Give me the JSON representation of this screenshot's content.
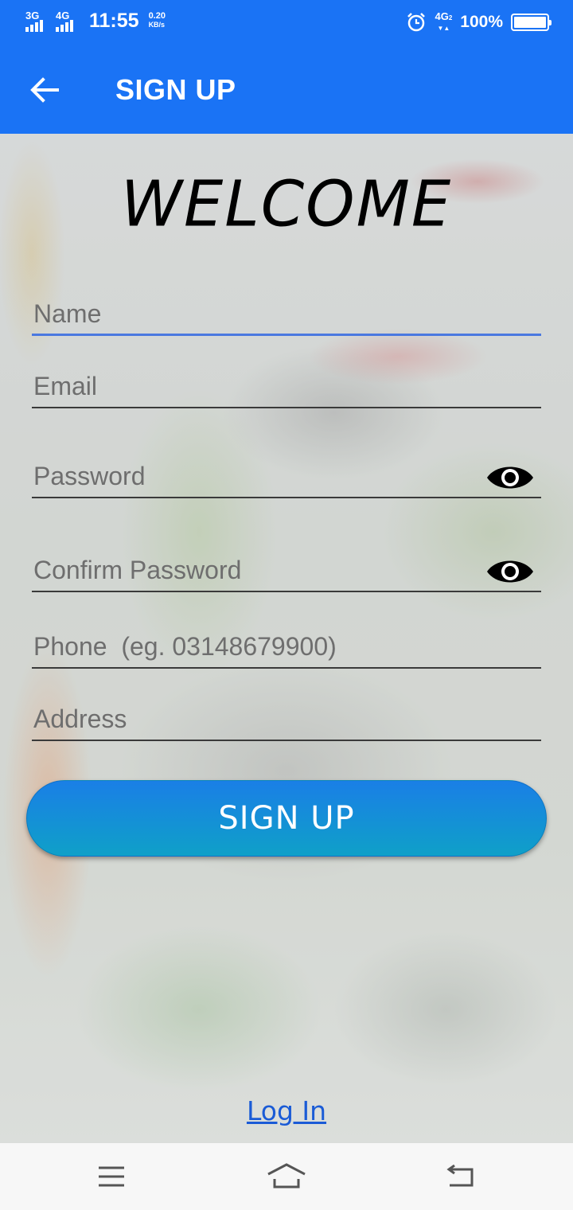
{
  "status_bar": {
    "network_1": "3G",
    "network_2": "4G",
    "time": "11:55",
    "speed_value": "0.20",
    "speed_unit": "KB/s",
    "network_right": "4G",
    "network_right_sub": "2",
    "battery": "100%",
    "battery_level": 1.0
  },
  "toolbar": {
    "title": "SIGN UP"
  },
  "form": {
    "heading": "WELCOME",
    "name_placeholder": "Name",
    "email_placeholder": "Email",
    "password_placeholder": "Password",
    "confirm_password_placeholder": "Confirm Password",
    "phone_placeholder": "Phone  (eg. 03148679900)",
    "address_placeholder": "Address",
    "submit_label": "SIGN UP",
    "login_link": "Log In"
  },
  "colors": {
    "primary": "#1a73f5",
    "active_underline": "#4a78e0",
    "button_top": "#1a7fe6",
    "button_bottom": "#0fa0c8",
    "link": "#1a5bd6"
  },
  "icons": {
    "back": "arrow-left-icon",
    "password_toggle": "eye-icon",
    "nav_menu": "menu-icon",
    "nav_home": "home-icon",
    "nav_back": "back-icon"
  }
}
